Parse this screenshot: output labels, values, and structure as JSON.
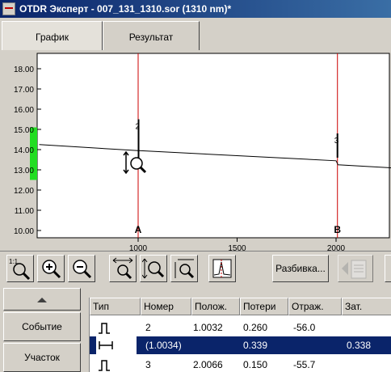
{
  "window": {
    "title": "OTDR Эксперт - 007_131_1310.sor (1310 nm)*"
  },
  "tabs": [
    {
      "label": "График",
      "active": true
    },
    {
      "label": "Результат",
      "active": false
    }
  ],
  "chart_data": {
    "type": "line",
    "yticks": [
      "18.00",
      "17.00",
      "16.00",
      "15.00",
      "14.00",
      "13.00",
      "12.00",
      "11.00",
      "10.00"
    ],
    "xticks": [
      1000,
      1500,
      2000
    ],
    "xlim": [
      500,
      2280
    ],
    "ylim": [
      10.0,
      18.5
    ],
    "series": [
      {
        "x": [
          500,
          1000,
          1005,
          2000,
          2010,
          2280
        ],
        "y": [
          14.25,
          13.95,
          13.95,
          13.45,
          13.25,
          13.1
        ]
      }
    ],
    "spikes": [
      {
        "x": 1002,
        "y_top": 15.5,
        "label": "2"
      },
      {
        "x": 2007,
        "y_top": 14.8,
        "label": "3"
      }
    ],
    "markers": [
      {
        "label": "A",
        "x": 1000
      },
      {
        "label": "B",
        "x": 2007
      }
    ],
    "level_bar": {
      "from": 12.5,
      "to": 15.1,
      "color": "#22dd22"
    },
    "marker_color": "#cc0000",
    "grid": false
  },
  "toolbar": {
    "buttons": [
      "zoom-1to1-icon",
      "zoom-in-icon",
      "zoom-out-icon",
      "zoom-horizontal-icon",
      "zoom-vertical-icon",
      "zoom-both-icon",
      "peak-zoom-icon"
    ],
    "zoom_1to1_label": "1:1",
    "split_label": "Разбивка...",
    "next_icon": "export-report-icon"
  },
  "sidebar": {
    "scroll_up_icon": "triangle-up-icon",
    "event_label": "Событие",
    "section_label": "Участок"
  },
  "table": {
    "columns": [
      "Тип",
      "Номер",
      "Полож.",
      "Потери",
      "Отраж.",
      "Зат."
    ],
    "rows": [
      {
        "icon": "reflective-event-icon",
        "number": "2",
        "position": "1.0032",
        "loss": "0.260",
        "reflectance": "-56.0",
        "attenuation": "",
        "selected": false
      },
      {
        "icon": "section-icon",
        "number": "(1.0034)",
        "position": "",
        "loss": "0.339",
        "reflectance": "",
        "attenuation": "0.338",
        "selected": true
      },
      {
        "icon": "reflective-event-icon",
        "number": "3",
        "position": "2.0066",
        "loss": "0.150",
        "reflectance": "-55.7",
        "attenuation": "",
        "selected": false
      }
    ]
  }
}
